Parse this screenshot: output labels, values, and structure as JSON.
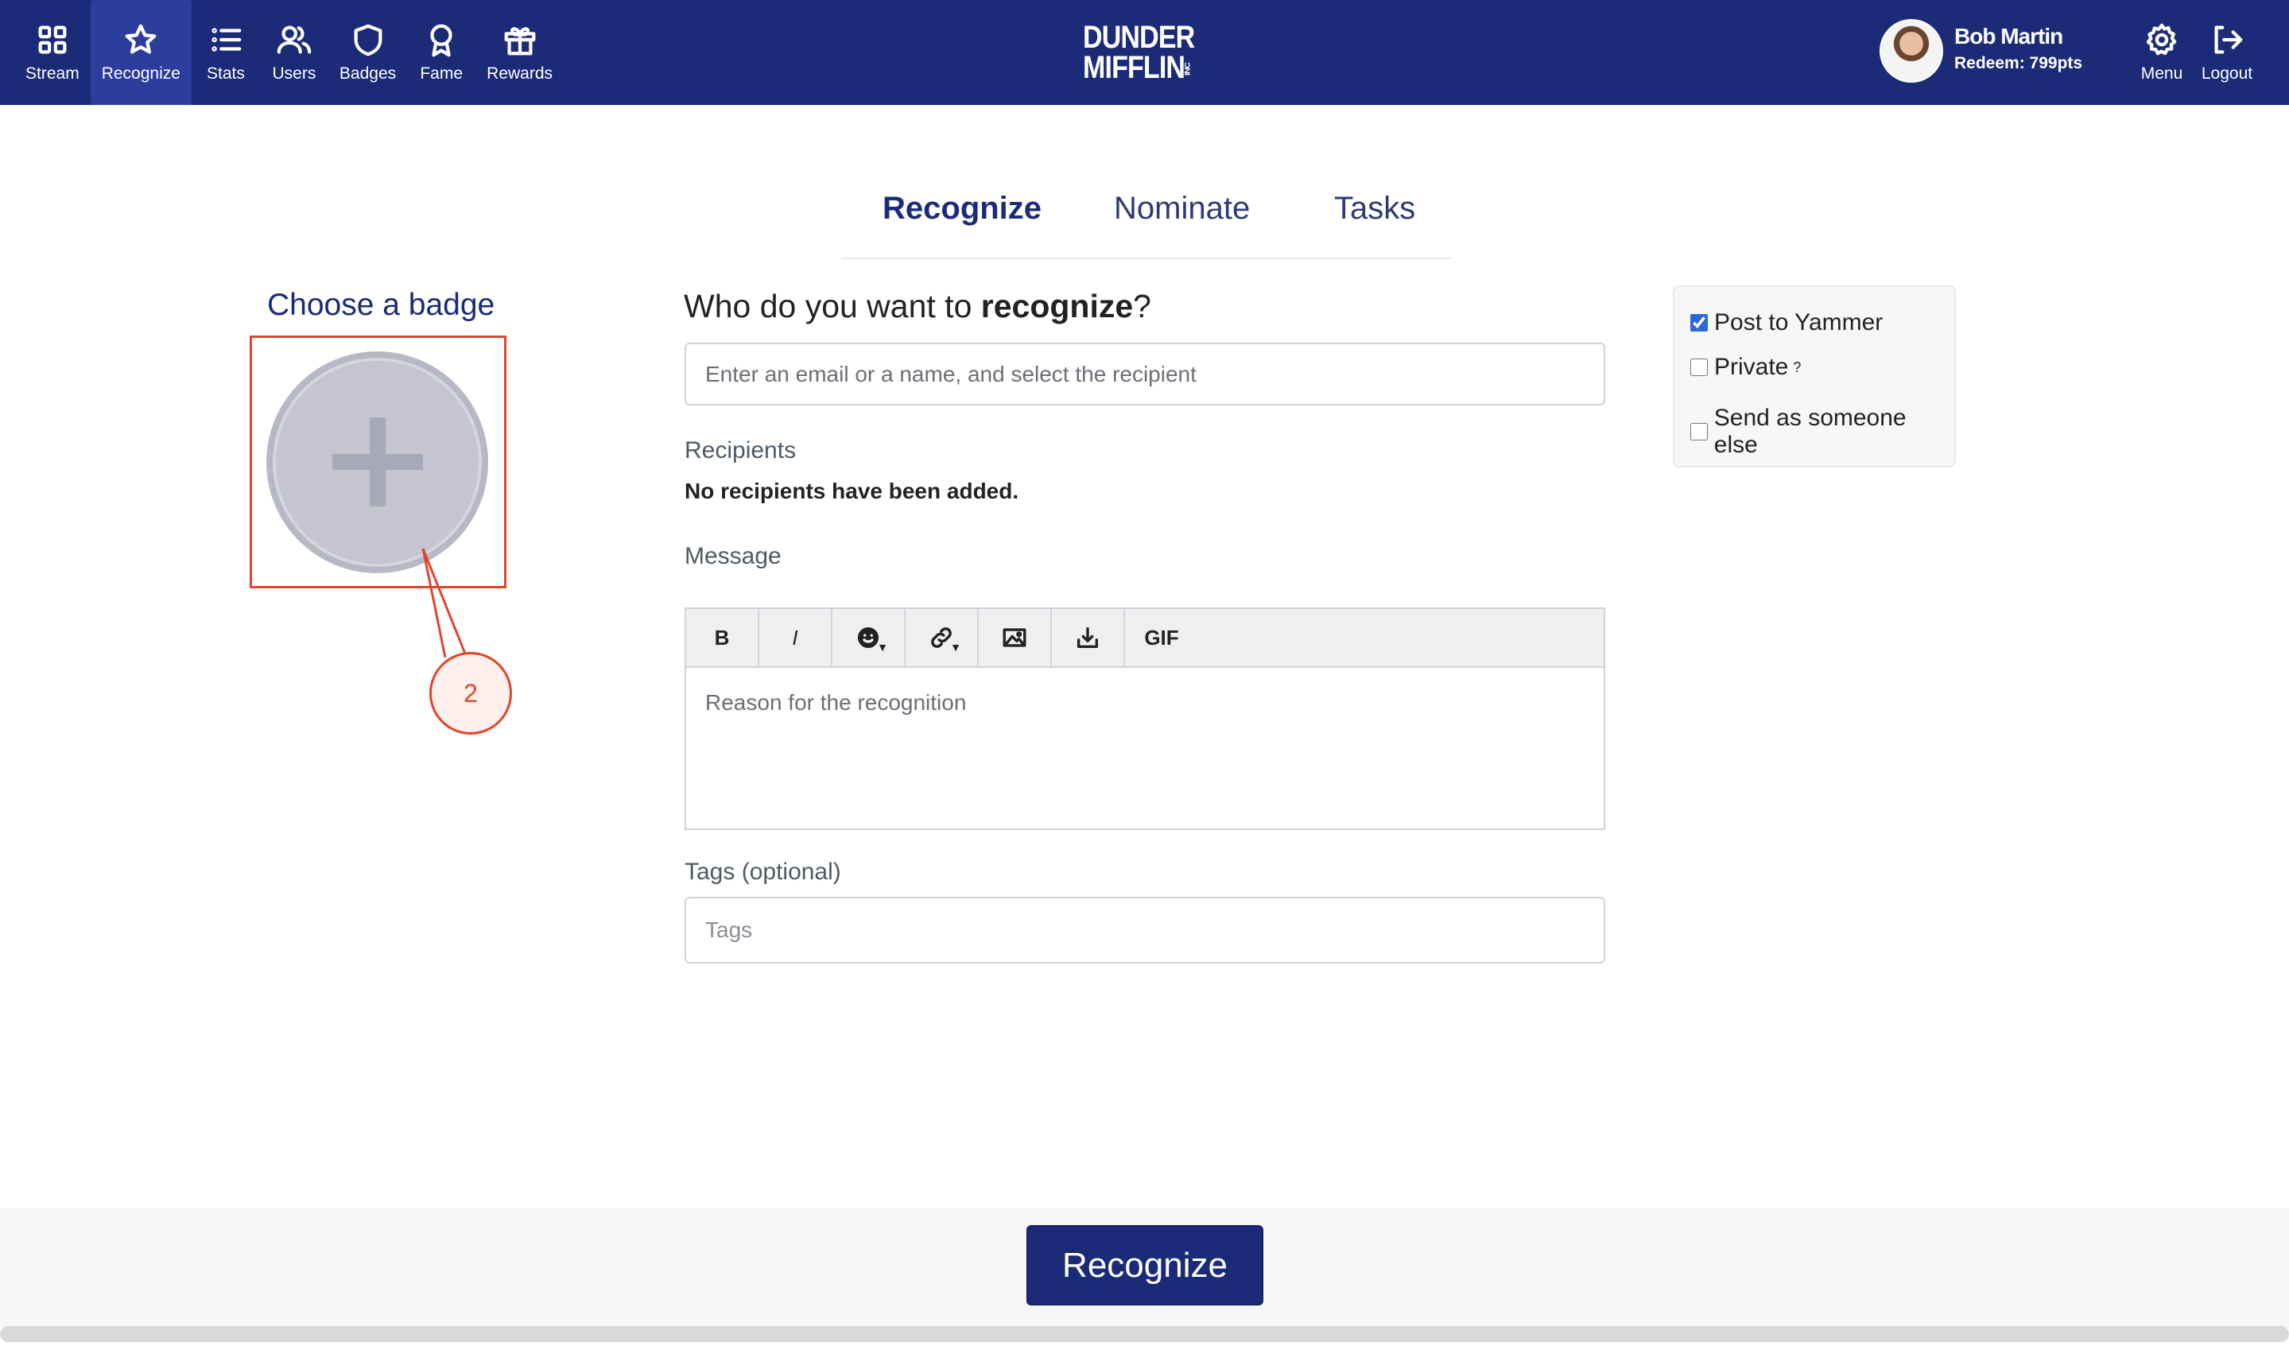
{
  "nav": {
    "items": [
      {
        "label": "Stream",
        "icon": "grid-icon"
      },
      {
        "label": "Recognize",
        "icon": "star-icon",
        "active": true
      },
      {
        "label": "Stats",
        "icon": "list-icon"
      },
      {
        "label": "Users",
        "icon": "users-icon"
      },
      {
        "label": "Badges",
        "icon": "shield-icon"
      },
      {
        "label": "Fame",
        "icon": "award-icon"
      },
      {
        "label": "Rewards",
        "icon": "gift-icon"
      }
    ],
    "right": [
      {
        "label": "Menu",
        "icon": "gear-icon"
      },
      {
        "label": "Logout",
        "icon": "logout-icon"
      }
    ]
  },
  "brand": {
    "line1": "DUNDER",
    "line2": "MIFFLIN",
    "suffix": "INC"
  },
  "user": {
    "name": "Bob Martin",
    "points": "Redeem: 799pts"
  },
  "tabs": [
    "Recognize",
    "Nominate",
    "Tasks"
  ],
  "badge": {
    "title": "Choose a badge",
    "callout": "2"
  },
  "form": {
    "question_prefix": "Who do you want to ",
    "question_bold": "recognize",
    "question_suffix": "?",
    "recipient_placeholder": "Enter an email or a name, and select the recipient",
    "recipients_label": "Recipients",
    "no_recipients": "No recipients have been added.",
    "message_label": "Message",
    "message_placeholder": "Reason for the recognition",
    "toolbar": {
      "bold": "B",
      "italic": "I",
      "gif": "GIF"
    },
    "tags_label": "Tags (optional)",
    "tags_placeholder": "Tags"
  },
  "options": {
    "post_to_yammer": {
      "label": "Post to Yammer",
      "checked": true
    },
    "private": {
      "label": "Private",
      "hint": "?",
      "checked": false
    },
    "send_as": {
      "label": "Send as someone else",
      "checked": false
    }
  },
  "footer": {
    "submit_label": "Recognize"
  },
  "colors": {
    "brand": "#1c2b78",
    "annotation": "#e0452a"
  }
}
